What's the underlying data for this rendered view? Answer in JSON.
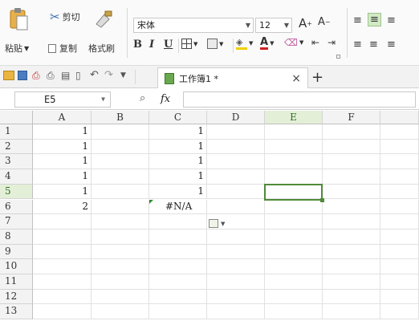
{
  "ribbon": {
    "paste_label": "粘贴",
    "cut_label": "剪切",
    "copy_label": "复制",
    "format_painter_label": "格式刷",
    "font_name": "宋体",
    "font_size": "12",
    "bold": "B",
    "italic": "I",
    "underline": "U"
  },
  "toolbar": {
    "doc_tab_title": "工作簿1 *",
    "close_tab": "×",
    "new_tab": "+"
  },
  "formula_bar": {
    "name_box": "E5",
    "fx_label": "fx",
    "formula": ""
  },
  "sheet": {
    "columns": [
      "A",
      "B",
      "C",
      "D",
      "E",
      "F"
    ],
    "rows": [
      "1",
      "2",
      "3",
      "4",
      "5",
      "6",
      "7",
      "8",
      "9",
      "10",
      "11",
      "12",
      "13"
    ],
    "active_column": "E",
    "active_row": "5",
    "cells": {
      "A1": "1",
      "A2": "1",
      "A3": "1",
      "A4": "1",
      "A5": "1",
      "A6": "2",
      "C1": "1",
      "C2": "1",
      "C3": "1",
      "C4": "1",
      "C5": "1",
      "C6": "#N/A"
    }
  },
  "colors": {
    "accent_green": "#4f8a3a",
    "header_highlight": "#e3efd7"
  }
}
